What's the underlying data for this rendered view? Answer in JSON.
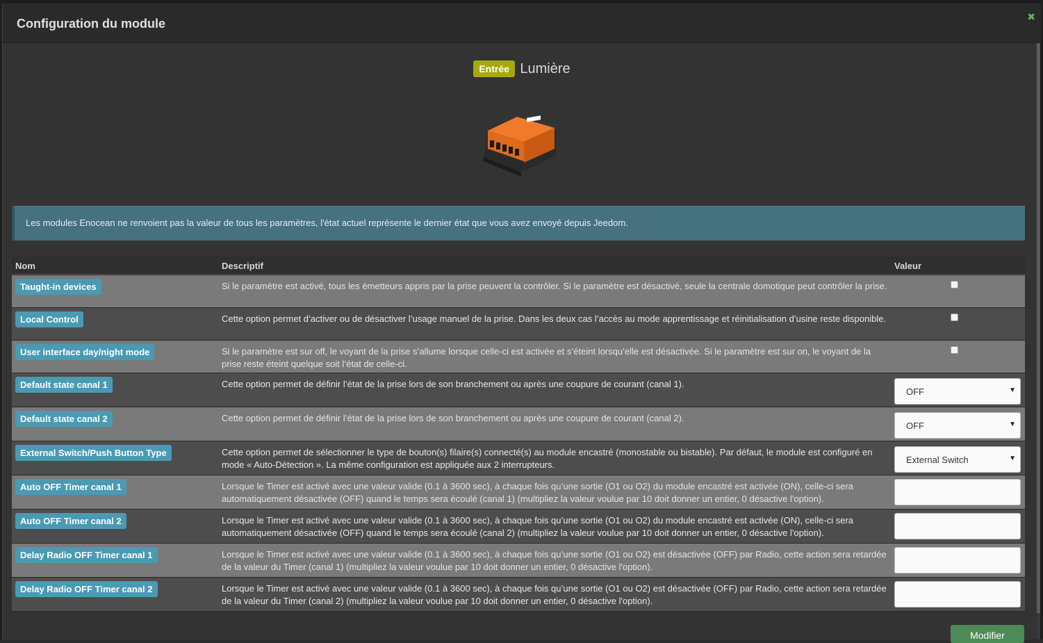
{
  "modal": {
    "title": "Configuration du module",
    "close_icon": "close-icon"
  },
  "equipment": {
    "badge": "Entrée",
    "name": "Lumière",
    "image": "enocean-module-image"
  },
  "alert": {
    "text": "Les modules Enocean ne renvoient pas la valeur de tous les paramètres, l'état actuel représente le dernier état que vous avez envoyé depuis Jeedom."
  },
  "table": {
    "headers": {
      "name": "Nom",
      "desc": "Descriptif",
      "value": "Valeur"
    },
    "rows": [
      {
        "name": "Taught-in devices",
        "desc": "Si le paramètre est activé, tous les émetteurs appris par la prise peuvent la contrôler. Si le paramètre est désactivé, seule la centrale domotique peut contrôler la prise.",
        "control": "checkbox",
        "checked": false
      },
      {
        "name": "Local Control",
        "desc": "Cette option permet d’activer ou de désactiver l’usage manuel de la prise. Dans les deux cas l’accès au mode apprentissage et réinitialisation d’usine reste disponible.",
        "control": "checkbox",
        "checked": false
      },
      {
        "name": "User interface day/night mode",
        "desc": "Si le paramètre est sur off, le voyant de la prise s’allume lorsque celle-ci est activée et s’éteint lorsqu’elle est désactivée. Si le paramètre est sur on, le voyant de la prise reste éteint quelque soit l’état de celle-ci.",
        "control": "checkbox",
        "checked": false
      },
      {
        "name": "Default state canal 1",
        "desc": "Cette option permet de définir l’état de la prise lors de son branchement ou après une coupure de courant (canal 1).",
        "control": "select",
        "value": "OFF"
      },
      {
        "name": "Default state canal 2",
        "desc": "Cette option permet de définir l’état de la prise lors de son branchement ou après une coupure de courant (canal 2).",
        "control": "select",
        "value": "OFF"
      },
      {
        "name": "External Switch/Push Button Type",
        "desc": "Cette option permet de sélectionner le type de bouton(s) filaire(s) connecté(s) au module encastré (monostable ou bistable). Par défaut, le module est configuré en mode « Auto-Détection ». La même configuration est appliquée aux 2 interrupteurs.",
        "control": "select",
        "value": "External Switch"
      },
      {
        "name": "Auto OFF Timer canal 1",
        "desc": "Lorsque le Timer est activé avec une valeur valide (0.1 à 3600 sec), à chaque fois qu’une sortie (O1 ou O2) du module encastré est activée (ON), celle-ci sera automatiquement désactivée (OFF) quand le temps sera écoulé (canal 1) (multipliez la valeur voulue par 10 doit donner un entier, 0 désactive l'option).",
        "control": "input",
        "value": ""
      },
      {
        "name": "Auto OFF Timer canal 2",
        "desc": "Lorsque le Timer est activé avec une valeur valide (0.1 à 3600 sec), à chaque fois qu’une sortie (O1 ou O2) du module encastré est activée (ON), celle-ci sera automatiquement désactivée (OFF) quand le temps sera écoulé (canal 2) (multipliez la valeur voulue par 10 doit donner un entier, 0 désactive l'option).",
        "control": "input",
        "value": ""
      },
      {
        "name": "Delay Radio OFF Timer canal 1",
        "desc": "Lorsque le Timer est activé avec une valeur valide (0.1 à 3600 sec), à chaque fois qu’une sortie (O1 ou O2) est désactivée (OFF) par Radio, cette action sera retardée de la valeur du Timer (canal 1) (multipliez la valeur voulue par 10 doit donner un entier, 0 désactive l'option).",
        "control": "input",
        "value": ""
      },
      {
        "name": "Delay Radio OFF Timer canal 2",
        "desc": "Lorsque le Timer est activé avec une valeur valide (0.1 à 3600 sec), à chaque fois qu’une sortie (O1 ou O2) est désactivée (OFF) par Radio, cette action sera retardée de la valeur du Timer (canal 2) (multipliez la valeur voulue par 10 doit donner un entier, 0 désactive l'option).",
        "control": "input",
        "value": ""
      }
    ]
  },
  "footer": {
    "save_label": "Modifier"
  },
  "colors": {
    "badge_entree": "#a8a80f",
    "name_badge": "#4a9ab3",
    "alert": "#467280",
    "save": "#4c8a58",
    "close": "#5cb85c"
  }
}
